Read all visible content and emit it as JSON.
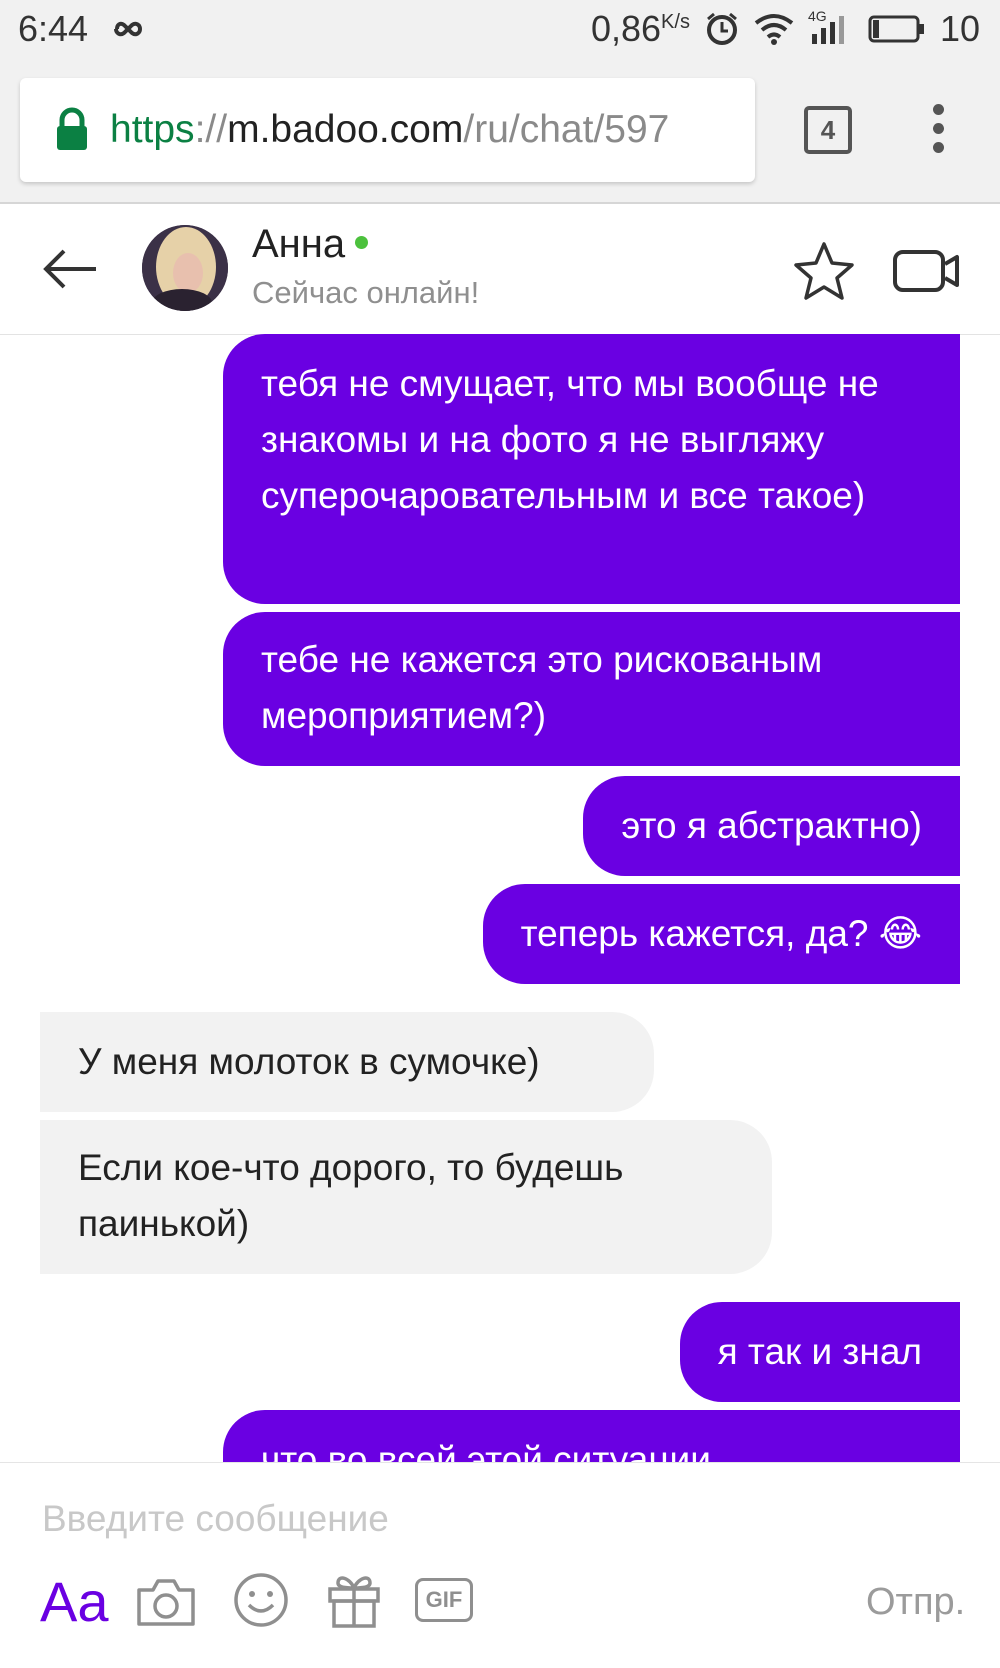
{
  "status_bar": {
    "time": "6:44",
    "net_speed": "0,86",
    "net_unit": "K/s",
    "network_type": "4G",
    "battery": "10"
  },
  "browser": {
    "url_scheme": "https",
    "url_sep": "://",
    "url_host": "m.badoo.com",
    "url_path": "/ru/chat/597",
    "tab_count": "4"
  },
  "chat_header": {
    "contact_name": "Анна",
    "contact_status": "Сейчас онлайн!"
  },
  "messages": [
    {
      "direction": "out",
      "text": "тебя не смущает, что мы вообще не знакомы и на фото я не выгляжу суперочаровательным и все такое)"
    },
    {
      "direction": "out",
      "text": "тебе не кажется это рискованым мероприятием?)"
    },
    {
      "direction": "out",
      "text": "это я абстрактно)"
    },
    {
      "direction": "out",
      "text": "теперь кажется, да? 😂"
    },
    {
      "direction": "in",
      "text": "У меня молоток в сумочке)"
    },
    {
      "direction": "in",
      "text": "Если кое-что дорого, то будешь паинькой)"
    },
    {
      "direction": "out",
      "text": "я так и знал"
    },
    {
      "direction": "out",
      "text": "что во всей этой ситуации"
    }
  ],
  "composer": {
    "placeholder": "Введите сообщение",
    "font_button": "Aa",
    "gif_label": "GIF",
    "send_label": "Отпр."
  },
  "colors": {
    "accent": "#6a00e2",
    "incoming_bubble": "#f2f2f2",
    "online": "#4cc13d",
    "url_secure": "#0b8043"
  }
}
